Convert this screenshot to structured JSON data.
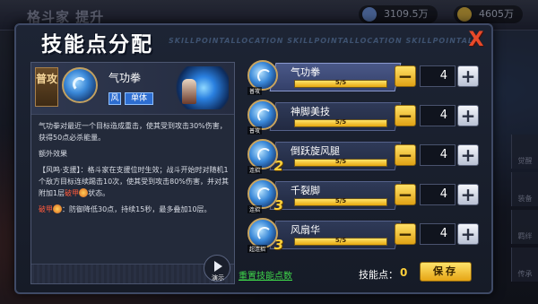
{
  "background": {
    "title": "格斗家 提升",
    "currency": [
      {
        "value": "3109.5万",
        "color": "#6a8fd8"
      },
      {
        "value": "4605万",
        "color": "#d8b040"
      }
    ],
    "side_tabs": [
      "觉醒",
      "装备",
      "羁绊",
      "传承"
    ]
  },
  "dialog": {
    "title": "技能点分配",
    "header_stripe": "SKILLPOINTALLOCATION SKILLPOINTALLOCATION SKILLPOINTALLOCATION",
    "close_label": "X"
  },
  "info": {
    "category": "普攻",
    "skill_name": "气功拳",
    "element_label": "风",
    "target_label": "单体",
    "description": "气功拳对最近一个目标造成重击，使其受到攻击30%伤害，获得50点必杀能量。",
    "extra_title": "额外效果",
    "extra_effect_1": "【风鸣·支援】：格斗家在支援位时生效；战斗开始时对随机1个敌方目标连续踢击10次，使其受到攻击80%伤害，并对其附加1层",
    "extra_effect_debuff": "破甲",
    "extra_effect_2": "状态。",
    "debuff_title": "破甲",
    "debuff_desc": "：防御降低30点，持续15秒，最多叠加10层。",
    "demo_label": "演示"
  },
  "skills": [
    {
      "name": "气功拳",
      "type": "普攻",
      "level_num": "",
      "progress": "5/5",
      "progress_fraction": 1.0,
      "count": "4"
    },
    {
      "name": "神脚美技",
      "type": "普攻",
      "level_num": "",
      "progress": "5/5",
      "progress_fraction": 1.0,
      "count": "4"
    },
    {
      "name": "倒跃旋风腿",
      "type": "连招",
      "level_num": "2",
      "progress": "5/5",
      "progress_fraction": 1.0,
      "count": "4"
    },
    {
      "name": "千裂脚",
      "type": "连招",
      "level_num": "3",
      "progress": "5/5",
      "progress_fraction": 1.0,
      "count": "4"
    },
    {
      "name": "风扇华",
      "type": "超连招",
      "level_num": "3",
      "progress": "5/5",
      "progress_fraction": 1.0,
      "count": "4"
    }
  ],
  "footer": {
    "reset_label": "重置技能点数",
    "points_label": "技能点：",
    "points_value": "0",
    "save_label": "保存"
  }
}
